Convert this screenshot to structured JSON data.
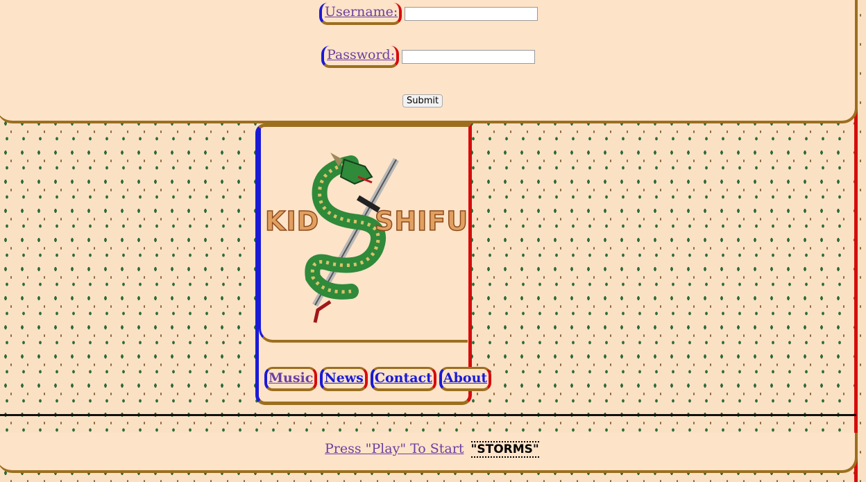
{
  "login": {
    "username_label": "Username:",
    "username_value": "",
    "password_label": "Password:",
    "password_value": "",
    "submit_label": "Submit"
  },
  "logo": {
    "word_left": "KID",
    "word_right": "SHIFU"
  },
  "nav": {
    "items": [
      "Music",
      "News",
      "Contact",
      "About"
    ]
  },
  "player": {
    "play_text": "Press \"Play\" To Start",
    "track_title": "\"STORMS\""
  },
  "colors": {
    "background": "#fbe1c4",
    "panel": "#fde3c8",
    "border_gold": "#9c6f1f",
    "border_blue": "#1a1ad6",
    "border_red": "#d60c0c",
    "link_purple": "#6b3fa0"
  }
}
